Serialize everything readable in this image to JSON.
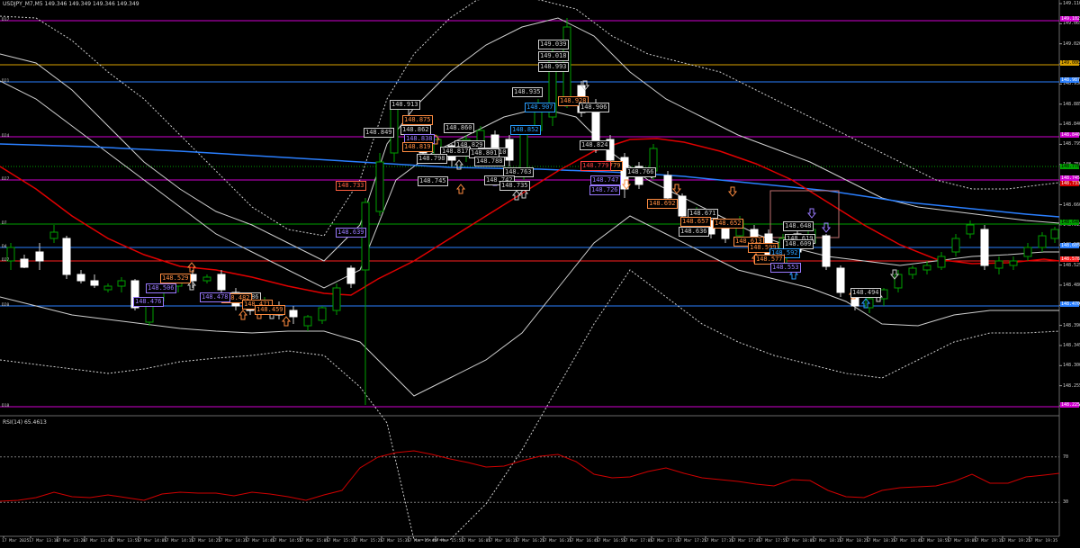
{
  "header": {
    "title": "USDJPY_M7,M5  149.346 149.349 149.346 149.349"
  },
  "rsi": {
    "title": "RSI(14) 65.4613",
    "levels": [
      "70",
      "30"
    ],
    "scale": [
      "70",
      "30"
    ]
  },
  "price_scale": {
    "ticks": [
      "149.110",
      "149.065",
      "149.020",
      "148.975",
      "148.930",
      "148.885",
      "148.840",
      "148.795",
      "148.750",
      "148.705",
      "148.660",
      "148.615",
      "148.570",
      "148.525",
      "148.480",
      "148.435",
      "148.390",
      "148.345",
      "148.300",
      "148.255",
      "148.210"
    ],
    "tags": [
      {
        "text": "149.102",
        "color": "#d100d1"
      },
      {
        "text": "149.000",
        "color": "#d8a100"
      },
      {
        "text": "148.987",
        "color": "#2a7fff"
      },
      {
        "text": "148.840",
        "color": "#d100d1"
      },
      {
        "text": "148.778",
        "color": "#00a000"
      },
      {
        "text": "148.745",
        "color": "#d100d1"
      },
      {
        "text": "148.733",
        "color": "#d10000"
      },
      {
        "text": "148.640",
        "color": "#00a000"
      },
      {
        "text": "148.605",
        "color": "#2a7fff"
      },
      {
        "text": "148.578",
        "color": "#ff2020"
      },
      {
        "text": "148.470",
        "color": "#2a7fff"
      },
      {
        "text": "148.225",
        "color": "#d100d1"
      }
    ]
  },
  "levels": [
    {
      "label": "D17",
      "color": "#d100d1"
    },
    {
      "label": "D21",
      "color": "#2a7fff"
    },
    {
      "label": "D24",
      "color": "#d100d1"
    },
    {
      "label": "D27",
      "color": "#d100d1"
    },
    {
      "label": "D7",
      "color": "#00a000"
    },
    {
      "label": "D4",
      "color": "#2a7fff"
    },
    {
      "label": "D27",
      "color": "#ff2020"
    },
    {
      "label": "D20",
      "color": "#2a7fff"
    },
    {
      "label": "D18",
      "color": "#d100d1"
    }
  ],
  "time_labels": [
    "17 Mar 2025",
    "17 Mar 13:10",
    "17 Mar 13:20",
    "17 Mar 13:45",
    "17 Mar 13:55",
    "17 Mar 14:05",
    "17 Mar 14:15",
    "17 Mar 14:25",
    "17 Mar 14:35",
    "17 Mar 14:45",
    "17 Mar 14:55",
    "17 Mar 15:05",
    "17 Mar 15:15",
    "17 Mar 15:25",
    "17 Mar 15:35",
    "17 Mar 15:45",
    "17 Mar 15:55",
    "17 Mar 16:05",
    "17 Mar 16:15",
    "17 Mar 16:25",
    "17 Mar 16:35",
    "17 Mar 16:45",
    "17 Mar 16:55",
    "17 Mar 17:05",
    "17 Mar 17:15",
    "17 Mar 17:25",
    "17 Mar 17:35",
    "17 Mar 17:45",
    "17 Mar 17:55",
    "17 Mar 18:05",
    "17 Mar 18:15",
    "17 Mar 18:25",
    "17 Mar 18:35",
    "17 Mar 18:45",
    "17 Mar 18:55",
    "17 Mar 19:05",
    "17 Mar 19:15",
    "17 Mar 19:25",
    "17 Mar 19:35"
  ],
  "price_marks": [
    {
      "text": "149.039",
      "color": "#cfcfcf"
    },
    {
      "text": "149.018",
      "color": "#cfcfcf"
    },
    {
      "text": "148.993",
      "color": "#cfcfcf"
    },
    {
      "text": "148.935",
      "color": "#cfcfcf"
    },
    {
      "text": "148.928",
      "color": "#ff8c40"
    },
    {
      "text": "148.913",
      "color": "#cfcfcf"
    },
    {
      "text": "148.907",
      "color": "#2a9fff"
    },
    {
      "text": "148.906",
      "color": "#cfcfcf"
    },
    {
      "text": "148.875",
      "color": "#ff8c40"
    },
    {
      "text": "148.862",
      "color": "#cfcfcf"
    },
    {
      "text": "148.860",
      "color": "#cfcfcf"
    },
    {
      "text": "148.852",
      "color": "#2a9fff"
    },
    {
      "text": "148.849",
      "color": "#cfcfcf"
    },
    {
      "text": "148.838",
      "color": "#9a7aff"
    },
    {
      "text": "148.829",
      "color": "#cfcfcf"
    },
    {
      "text": "148.824",
      "color": "#cfcfcf"
    },
    {
      "text": "148.819",
      "color": "#ff8c40"
    },
    {
      "text": "148.817",
      "color": "#cfcfcf"
    },
    {
      "text": "148.810",
      "color": "#cfcfcf"
    },
    {
      "text": "148.801",
      "color": "#cfcfcf"
    },
    {
      "text": "148.798",
      "color": "#cfcfcf"
    },
    {
      "text": "148.788",
      "color": "#cfcfcf"
    },
    {
      "text": "148.779",
      "color": "#ff8c40"
    },
    {
      "text": "148.779",
      "color": "#ff4040"
    },
    {
      "text": "148.766",
      "color": "#cfcfcf"
    },
    {
      "text": "148.763",
      "color": "#cfcfcf"
    },
    {
      "text": "148.747",
      "color": "#9a7aff"
    },
    {
      "text": "148.745",
      "color": "#cfcfcf"
    },
    {
      "text": "148.742",
      "color": "#cfcfcf"
    },
    {
      "text": "148.735",
      "color": "#cfcfcf"
    },
    {
      "text": "148.733",
      "color": "#ff6040"
    },
    {
      "text": "148.726",
      "color": "#9a7aff"
    },
    {
      "text": "148.692",
      "color": "#ff8c40"
    },
    {
      "text": "148.671",
      "color": "#cfcfcf"
    },
    {
      "text": "148.657",
      "color": "#ff8c40"
    },
    {
      "text": "148.652",
      "color": "#ff8c40"
    },
    {
      "text": "148.648",
      "color": "#cfcfcf"
    },
    {
      "text": "148.639",
      "color": "#9a7aff"
    },
    {
      "text": "148.636",
      "color": "#cfcfcf"
    },
    {
      "text": "148.619",
      "color": "#cfcfcf"
    },
    {
      "text": "148.613",
      "color": "#ff8c40"
    },
    {
      "text": "148.609",
      "color": "#cfcfcf"
    },
    {
      "text": "148.599",
      "color": "#ff8c40"
    },
    {
      "text": "148.592",
      "color": "#2a9fff"
    },
    {
      "text": "148.577",
      "color": "#ff8c40"
    },
    {
      "text": "148.553",
      "color": "#9a7aff"
    },
    {
      "text": "148.529",
      "color": "#ff8c40"
    },
    {
      "text": "148.506",
      "color": "#9a7aff"
    },
    {
      "text": "148.494",
      "color": "#cfcfcf"
    },
    {
      "text": "148.486",
      "color": "#cfcfcf"
    },
    {
      "text": "148.482",
      "color": "#ff8c40"
    },
    {
      "text": "148.478",
      "color": "#9a7aff"
    },
    {
      "text": "148.476",
      "color": "#9a7aff"
    },
    {
      "text": "148.471",
      "color": "#ff8c40"
    },
    {
      "text": "148.459",
      "color": "#ff8c40"
    }
  ]
}
